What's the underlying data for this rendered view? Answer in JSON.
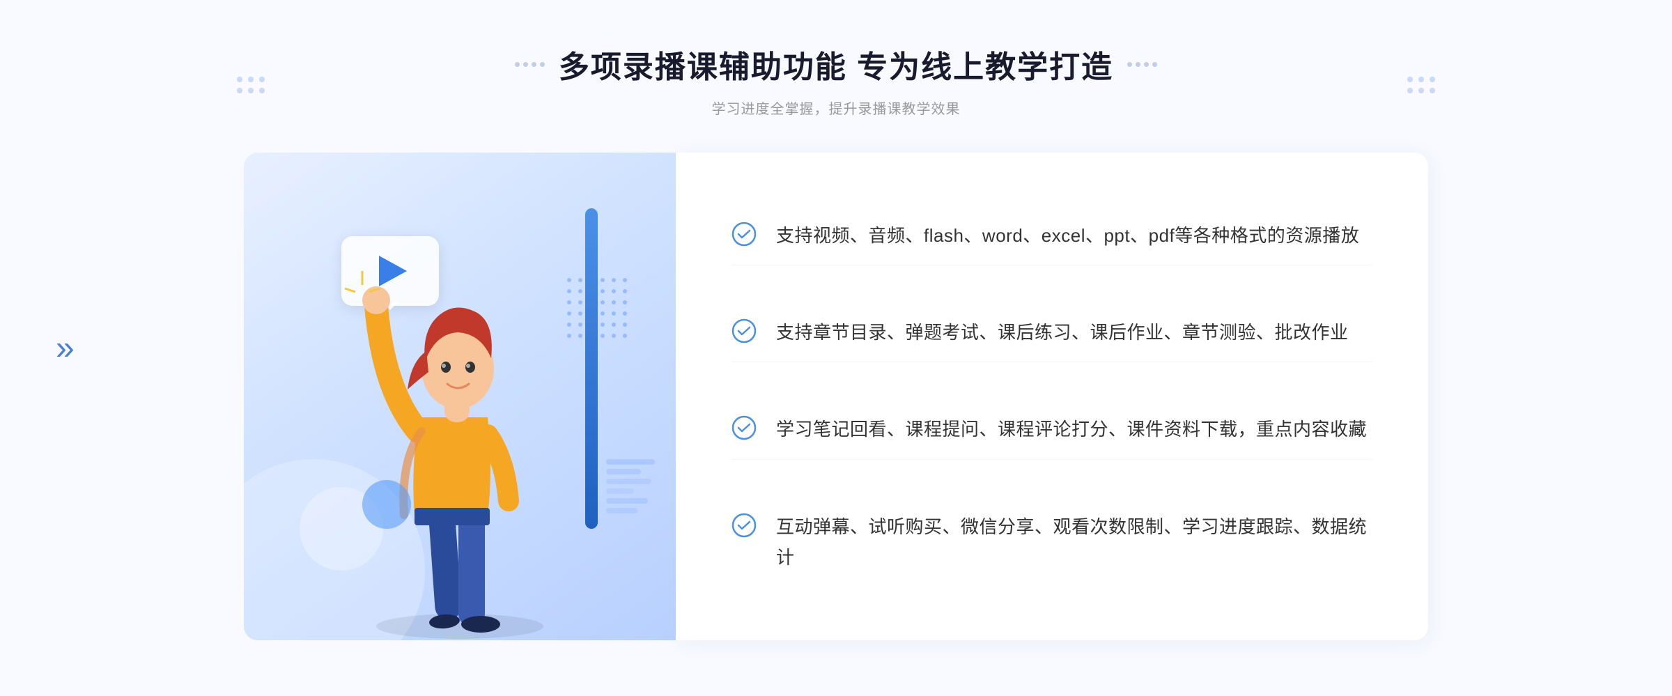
{
  "header": {
    "title": "多项录播课辅助功能 专为线上教学打造",
    "subtitle": "学习进度全掌握，提升录播课教学效果"
  },
  "features": [
    {
      "id": "feature-1",
      "text": "支持视频、音频、flash、word、excel、ppt、pdf等各种格式的资源播放"
    },
    {
      "id": "feature-2",
      "text": "支持章节目录、弹题考试、课后练习、课后作业、章节测验、批改作业"
    },
    {
      "id": "feature-3",
      "text": "学习笔记回看、课程提问、课程评论打分、课件资料下载，重点内容收藏"
    },
    {
      "id": "feature-4",
      "text": "互动弹幕、试听购买、微信分享、观看次数限制、学习进度跟踪、数据统计"
    }
  ],
  "colors": {
    "accent_blue": "#3a7ee8",
    "light_blue": "#5b9cf6",
    "title_color": "#1a1a2e",
    "text_color": "#333333",
    "subtitle_color": "#999999"
  }
}
